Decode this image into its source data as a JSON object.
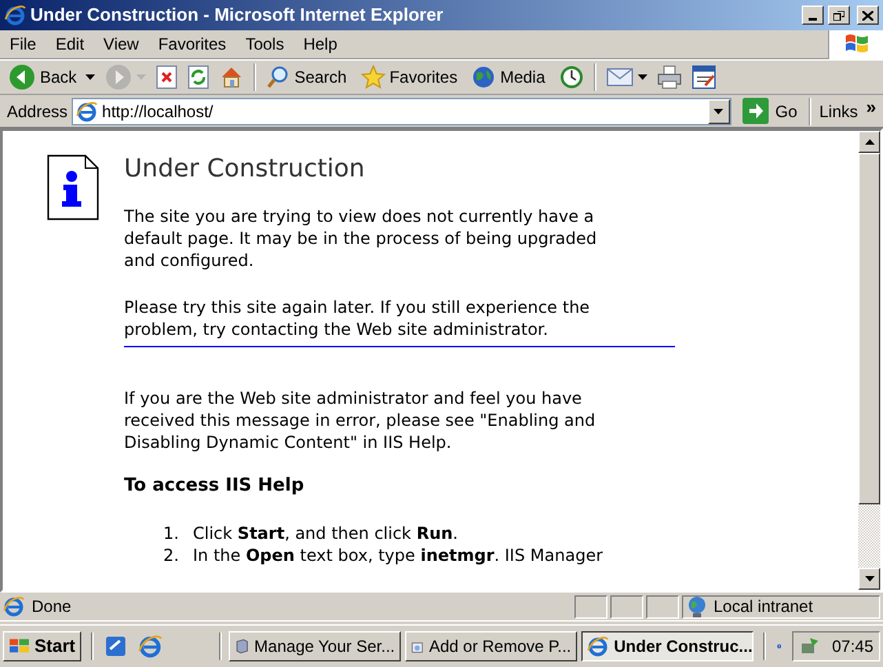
{
  "window": {
    "title": "Under Construction - Microsoft Internet Explorer"
  },
  "menu": [
    "File",
    "Edit",
    "View",
    "Favorites",
    "Tools",
    "Help"
  ],
  "toolbar": [
    {
      "kind": "back",
      "label": "Back",
      "disabled": false
    },
    {
      "kind": "forward",
      "disabled": true
    },
    {
      "kind": "stop",
      "disabled": false
    },
    {
      "kind": "refresh",
      "disabled": false
    },
    {
      "kind": "home",
      "disabled": false
    },
    {
      "kind": "separator"
    },
    {
      "kind": "search",
      "label": "Search",
      "disabled": false
    },
    {
      "kind": "favorites",
      "label": "Favorites",
      "disabled": false
    },
    {
      "kind": "media",
      "label": "Media",
      "disabled": false
    },
    {
      "kind": "history",
      "disabled": false
    },
    {
      "kind": "separator"
    },
    {
      "kind": "mail",
      "disabled": false
    },
    {
      "kind": "print",
      "disabled": false
    },
    {
      "kind": "edit",
      "disabled": false
    }
  ],
  "address": {
    "label": "Address",
    "value": "http://localhost/",
    "go": "Go",
    "links": "Links",
    "more": "»"
  },
  "page": {
    "heading": "Under Construction",
    "paragraphs": [
      "The site you are trying to view does not currently have a default page. It may be in the process of being upgraded and configured.",
      "Please try this site again later. If you still experience the problem, try contacting the Web site administrator."
    ],
    "paragraphs_after_rule": [
      "If you are the Web site administrator and feel you have received this message in error, please see \"Enabling and Disabling Dynamic Content\" in IIS Help."
    ],
    "subheading": "To access IIS Help",
    "steps": [
      {
        "number": "1.",
        "text": "Click **Start**, and then click **Run**."
      },
      {
        "number": "2.",
        "text": "In the **Open** text box, type **inetmgr**. IIS Manager"
      }
    ]
  },
  "status_bar": {
    "text": "Done",
    "zone": "Local intranet"
  },
  "taskbar": {
    "start": "Start",
    "tasks": [
      {
        "kind": "server",
        "label": "Manage Your Ser...",
        "selected": false
      },
      {
        "kind": "programs",
        "label": "Add or Remove P...",
        "selected": false
      },
      {
        "kind": "ie",
        "label": "Under Construc...",
        "selected": true
      }
    ],
    "clock": "07:45"
  }
}
